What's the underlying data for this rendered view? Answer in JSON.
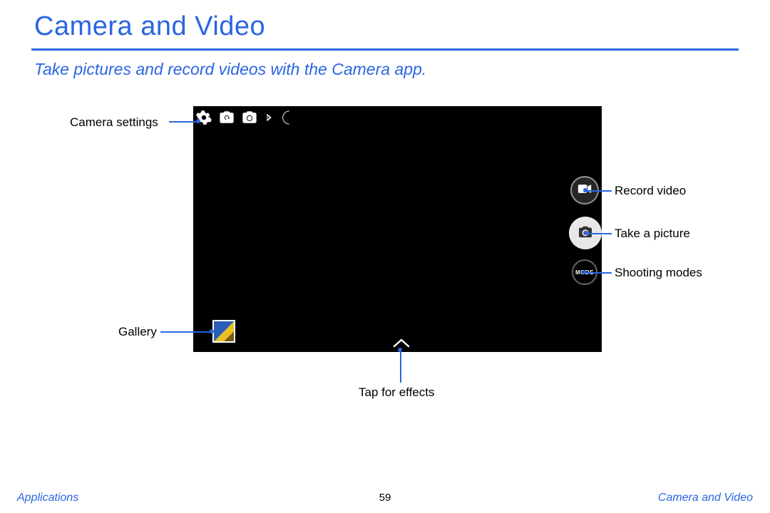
{
  "header": {
    "title": "Camera and Video",
    "subtitle": "Take pictures and record videos with the Camera app."
  },
  "camera": {
    "mode_label": "MODE"
  },
  "callouts": {
    "settings": "Camera settings",
    "record": "Record video",
    "shutter": "Take a picture",
    "modes": "Shooting modes",
    "gallery": "Gallery",
    "effects": "Tap for effects"
  },
  "footer": {
    "left": "Applications",
    "page": "59",
    "right": "Camera and Video"
  }
}
